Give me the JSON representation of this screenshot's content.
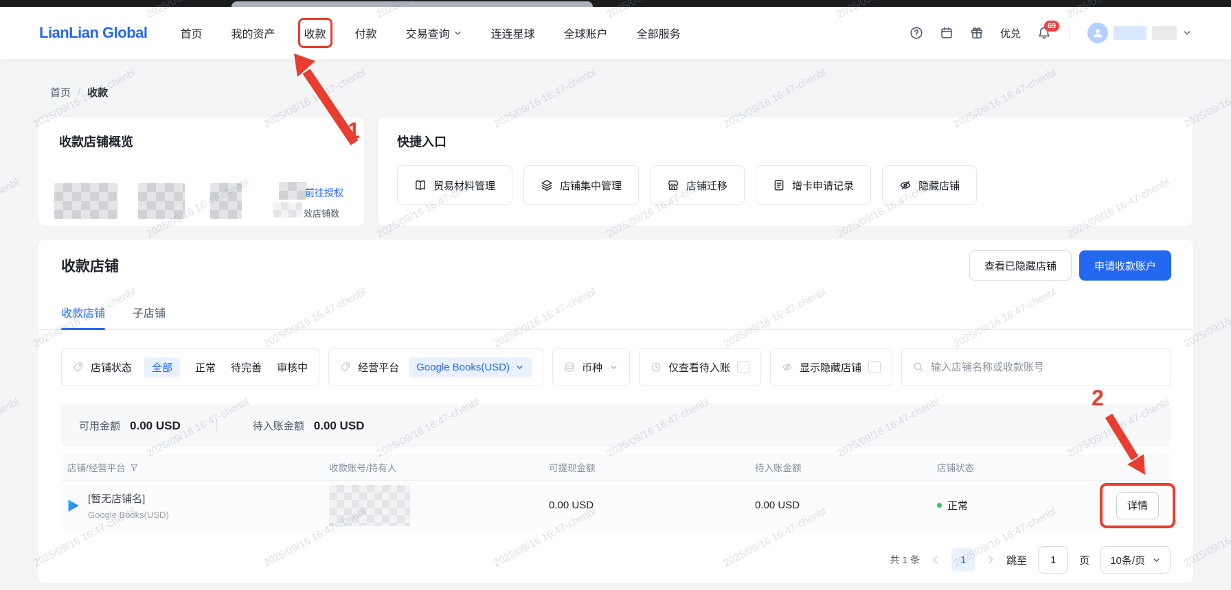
{
  "watermark": {
    "text": "2025/09/16 16:47-chenbl"
  },
  "header": {
    "logo": "LianLian Global",
    "nav": [
      {
        "label": "首页"
      },
      {
        "label": "我的资产"
      },
      {
        "label": "收款"
      },
      {
        "label": "付款"
      },
      {
        "label": "交易查询"
      },
      {
        "label": "连连星球"
      },
      {
        "label": "全球账户"
      },
      {
        "label": "全部服务"
      }
    ],
    "right": {
      "youdui_label": "优兑",
      "badge_count": "69"
    }
  },
  "breadcrumb": {
    "home": "首页",
    "current": "收款"
  },
  "overview_card": {
    "title": "收款店铺概览",
    "link": "前往授权",
    "partial_label": "效店铺数"
  },
  "quick_entry": {
    "title": "快捷入口",
    "items": [
      {
        "label": "贸易材料管理",
        "icon": "book-icon"
      },
      {
        "label": "店铺集中管理",
        "icon": "layers-icon"
      },
      {
        "label": "店铺迁移",
        "icon": "store-icon"
      },
      {
        "label": "增卡申请记录",
        "icon": "document-icon"
      },
      {
        "label": "隐藏店铺",
        "icon": "eye-off-icon"
      }
    ]
  },
  "main": {
    "title": "收款店铺",
    "buttons": {
      "view_hidden": "查看已隐藏店铺",
      "apply_account": "申请收款账户"
    },
    "tabs": [
      {
        "label": "收款店铺",
        "active": true
      },
      {
        "label": "子店铺",
        "active": false
      }
    ],
    "filters": {
      "shop_status": {
        "label": "店铺状态",
        "options": [
          "全部",
          "正常",
          "待完善",
          "审核中"
        ],
        "selected": "全部"
      },
      "platform": {
        "label": "经营平台",
        "value": "Google Books(USD)"
      },
      "currency": {
        "label": "币种"
      },
      "pending_only": {
        "label": "仅查看待入账",
        "checked": false
      },
      "show_hidden": {
        "label": "显示隐藏店铺",
        "checked": false
      },
      "search": {
        "placeholder": "输入店铺名称或收款账号"
      }
    },
    "summary": {
      "available_label": "可用金额",
      "available_value": "0.00 USD",
      "pending_label": "待入账金额",
      "pending_value": "0.00 USD"
    },
    "table": {
      "columns": [
        "店铺/经营平台",
        "收款账号/持有人",
        "可提现金额",
        "待入账金额",
        "店铺状态"
      ],
      "rows": [
        {
          "shop_name": "[暂无店铺名]",
          "platform": "Google Books(USD)",
          "withdrawable": "0.00 USD",
          "pending": "0.00 USD",
          "status": "正常",
          "action": "详情"
        }
      ]
    },
    "pagination": {
      "total": "共 1 条",
      "current_page": "1",
      "jump_label": "跳至",
      "jump_value": "1",
      "page_unit": "页",
      "page_size": "10条/页"
    }
  },
  "annotations": {
    "step1": "1",
    "step2": "2"
  },
  "colors": {
    "accent": "#2468f2",
    "annotation_red": "#e93d2f",
    "status_green": "#3dbd5b",
    "badge_red": "#f53f3f"
  }
}
